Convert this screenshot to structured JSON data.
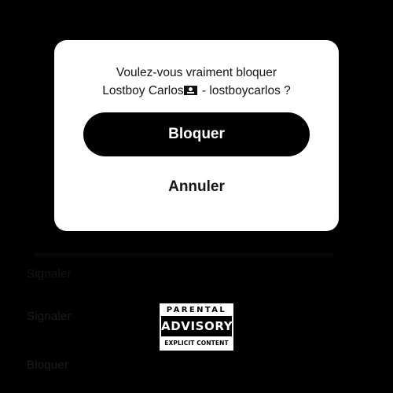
{
  "dialog": {
    "message_line1": "Voulez-vous vraiment bloquer",
    "message_name": "Lostboy Carlos",
    "message_rest": " - lostboycarlos ?",
    "flag_icon": "pirate-flag-icon",
    "confirm_label": "Bloquer",
    "cancel_label": "Annuler"
  },
  "background": {
    "row1": "Signaler",
    "row2": "Signaler",
    "row3": "Bloquer"
  },
  "advisory": {
    "line1": "PARENTAL",
    "line2": "ADVISORY",
    "line3": "EXPLICIT CONTENT"
  }
}
